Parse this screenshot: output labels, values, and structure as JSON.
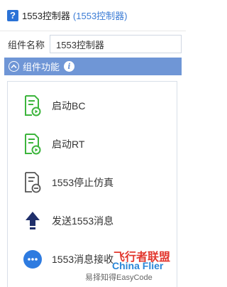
{
  "title": {
    "text": "1553控制器",
    "sub": "(1553控制器)"
  },
  "name_row": {
    "label": "组件名称",
    "value": "1553控制器"
  },
  "section": {
    "title": "组件功能"
  },
  "functions": [
    {
      "label": "启动BC",
      "icon": "doc-play-icon",
      "color": "#3db53d"
    },
    {
      "label": "启动RT",
      "icon": "doc-play-icon",
      "color": "#3db53d"
    },
    {
      "label": "1553停止仿真",
      "icon": "doc-stop-icon",
      "color": "#555555"
    },
    {
      "label": "发送1553消息",
      "icon": "upload-icon",
      "color": "#1f2f6b"
    },
    {
      "label": "1553消息接收",
      "icon": "chat-bubble-icon",
      "color": "#2e7be0"
    }
  ],
  "watermark": {
    "logo_cn": "飞行者联盟",
    "logo_en": "China Flier",
    "account": "易择知得EasyCode"
  },
  "colors": {
    "accent": "#6f96d6",
    "title_blue": "#3a7bd5",
    "green": "#3db53d"
  }
}
